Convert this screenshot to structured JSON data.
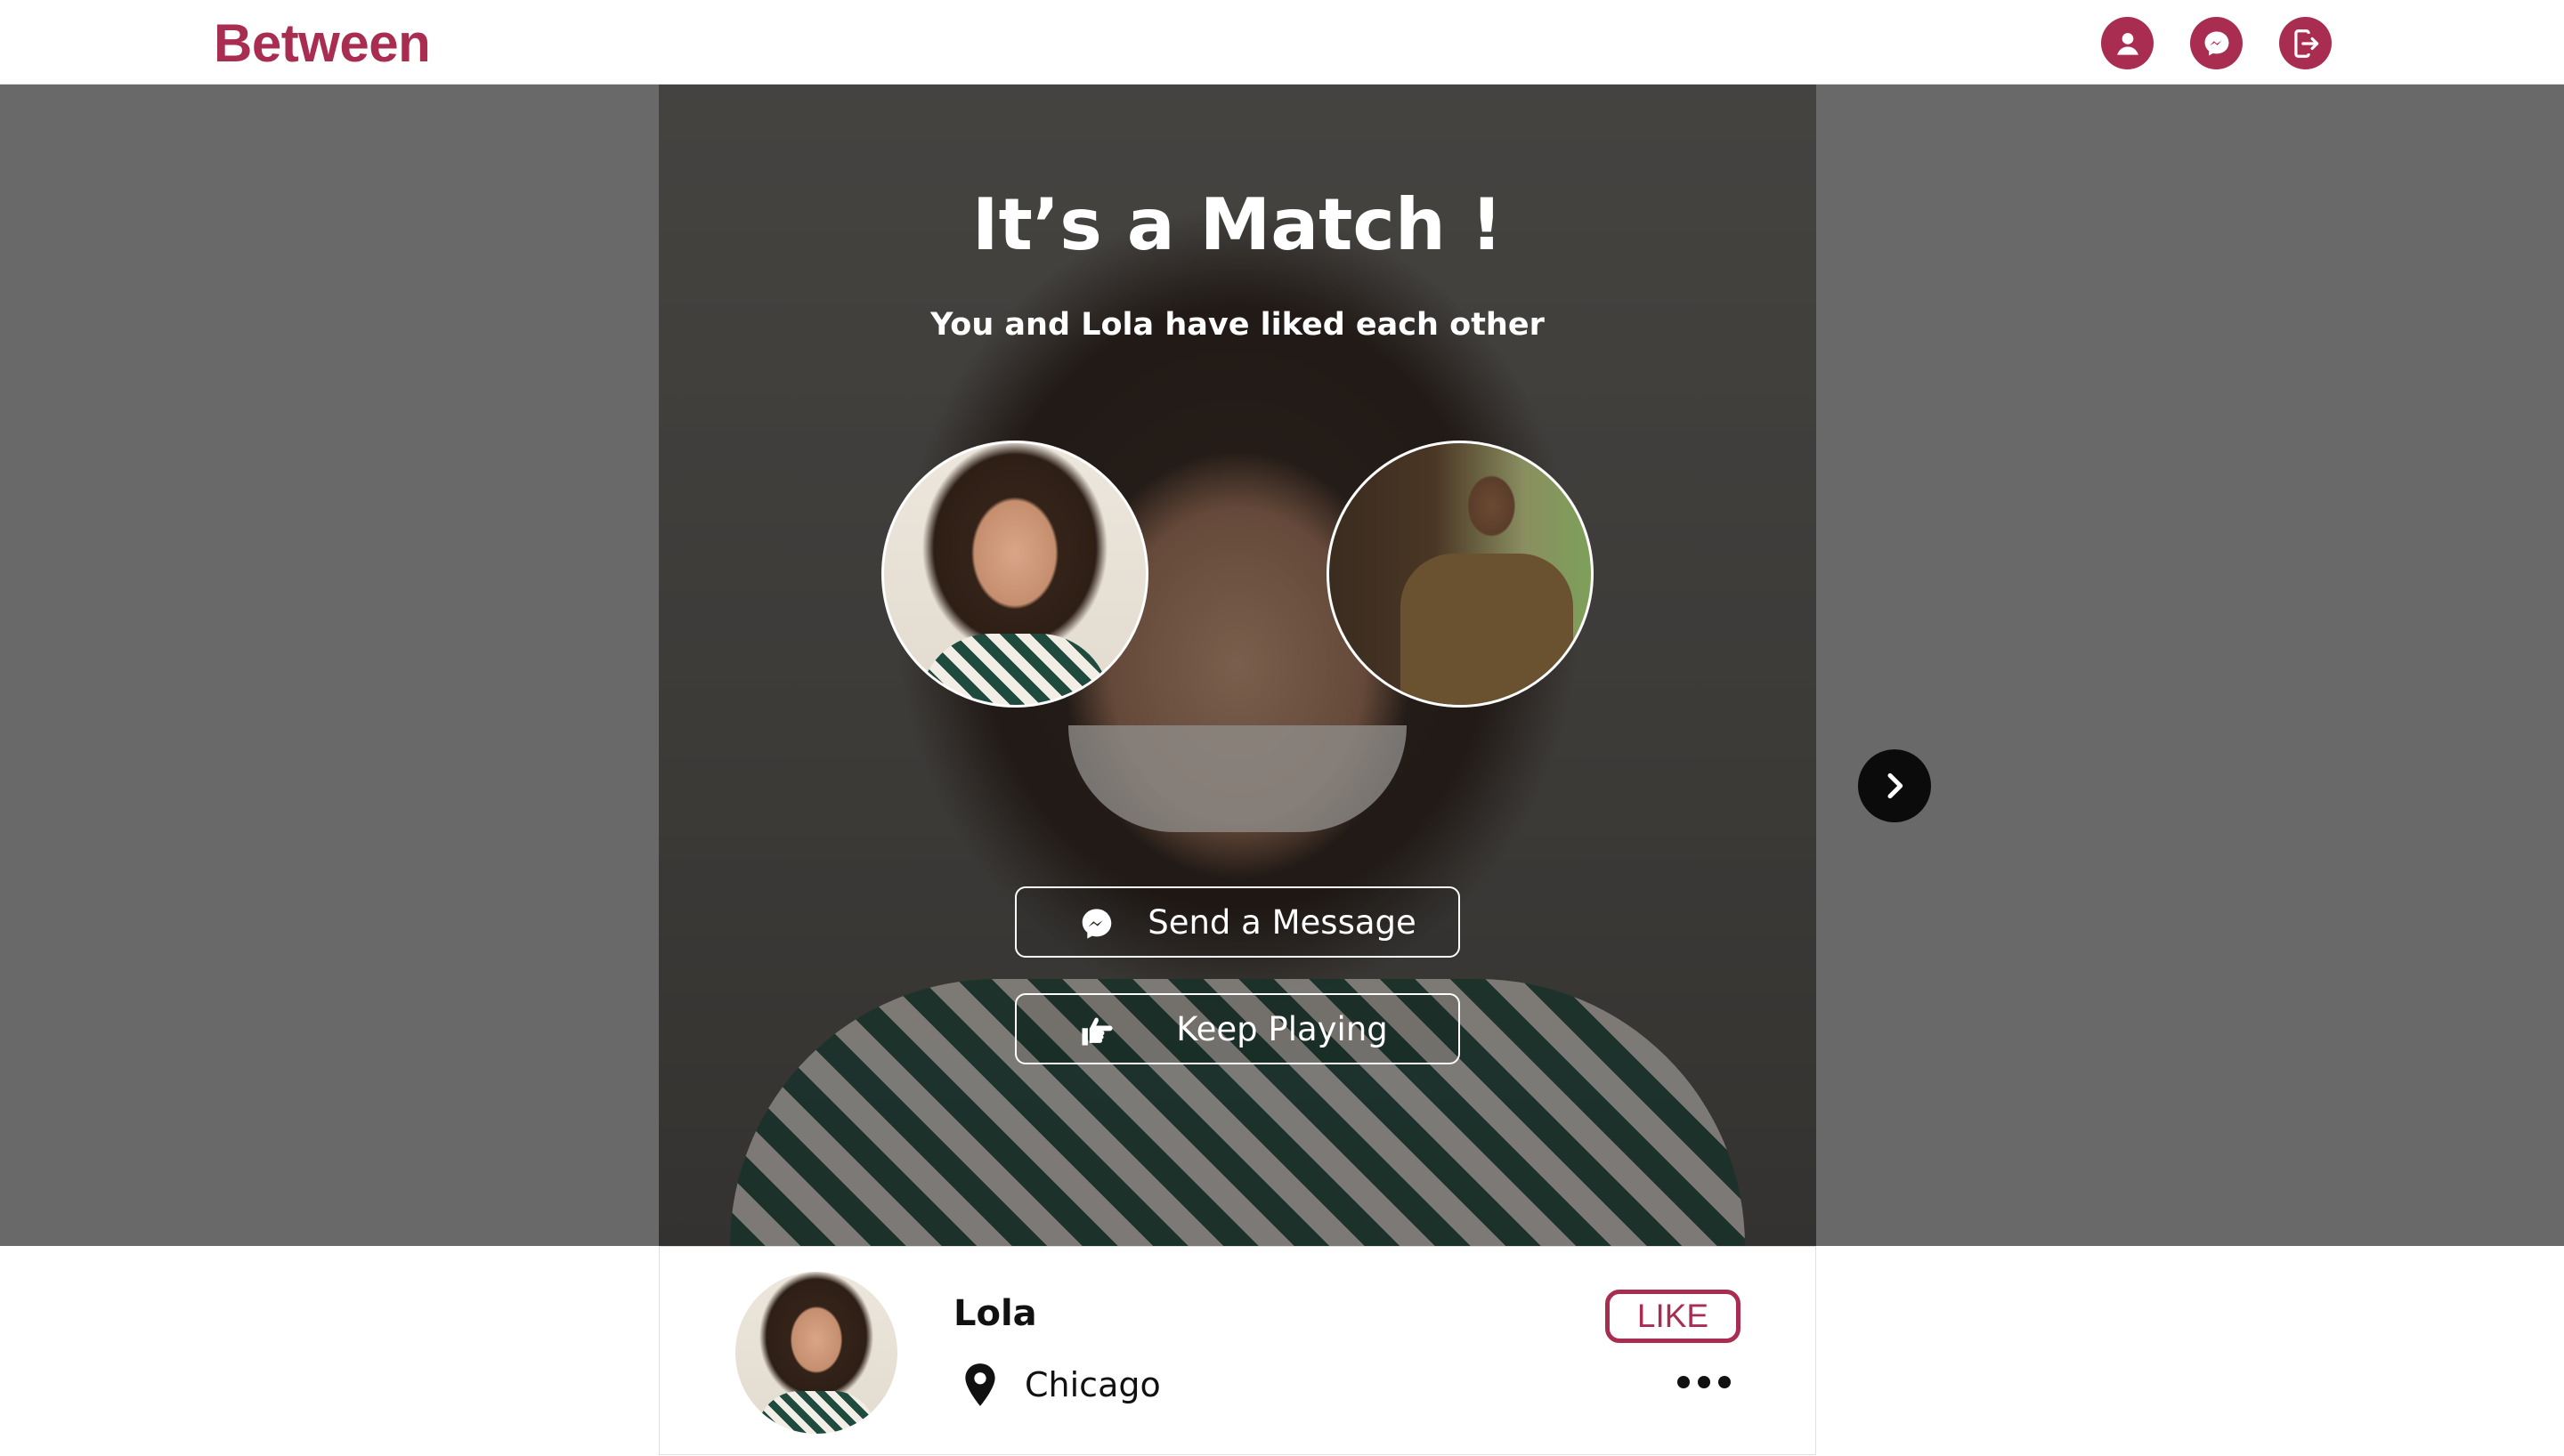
{
  "header": {
    "logo": "Between",
    "nav": [
      {
        "icon": "user-icon"
      },
      {
        "icon": "messenger-icon"
      },
      {
        "icon": "logout-icon"
      }
    ],
    "accent_color": "#a82d51"
  },
  "match_modal": {
    "title": "It’s a Match !",
    "subtitle": "You and Lola have liked each other",
    "avatars": [
      "lola-photo",
      "user-photo"
    ],
    "buttons": {
      "send_message": {
        "label": "Send a Message",
        "icon": "messenger-icon"
      },
      "keep_playing": {
        "label": "Keep Playing",
        "icon": "hand-pointing-icon"
      }
    }
  },
  "navigation": {
    "next_icon": "chevron-right-icon"
  },
  "profile": {
    "name": "Lola",
    "location": "Chicago",
    "location_icon": "map-pin-icon",
    "like_label": "LIKE",
    "more_icon": "more-horizontal-icon"
  }
}
